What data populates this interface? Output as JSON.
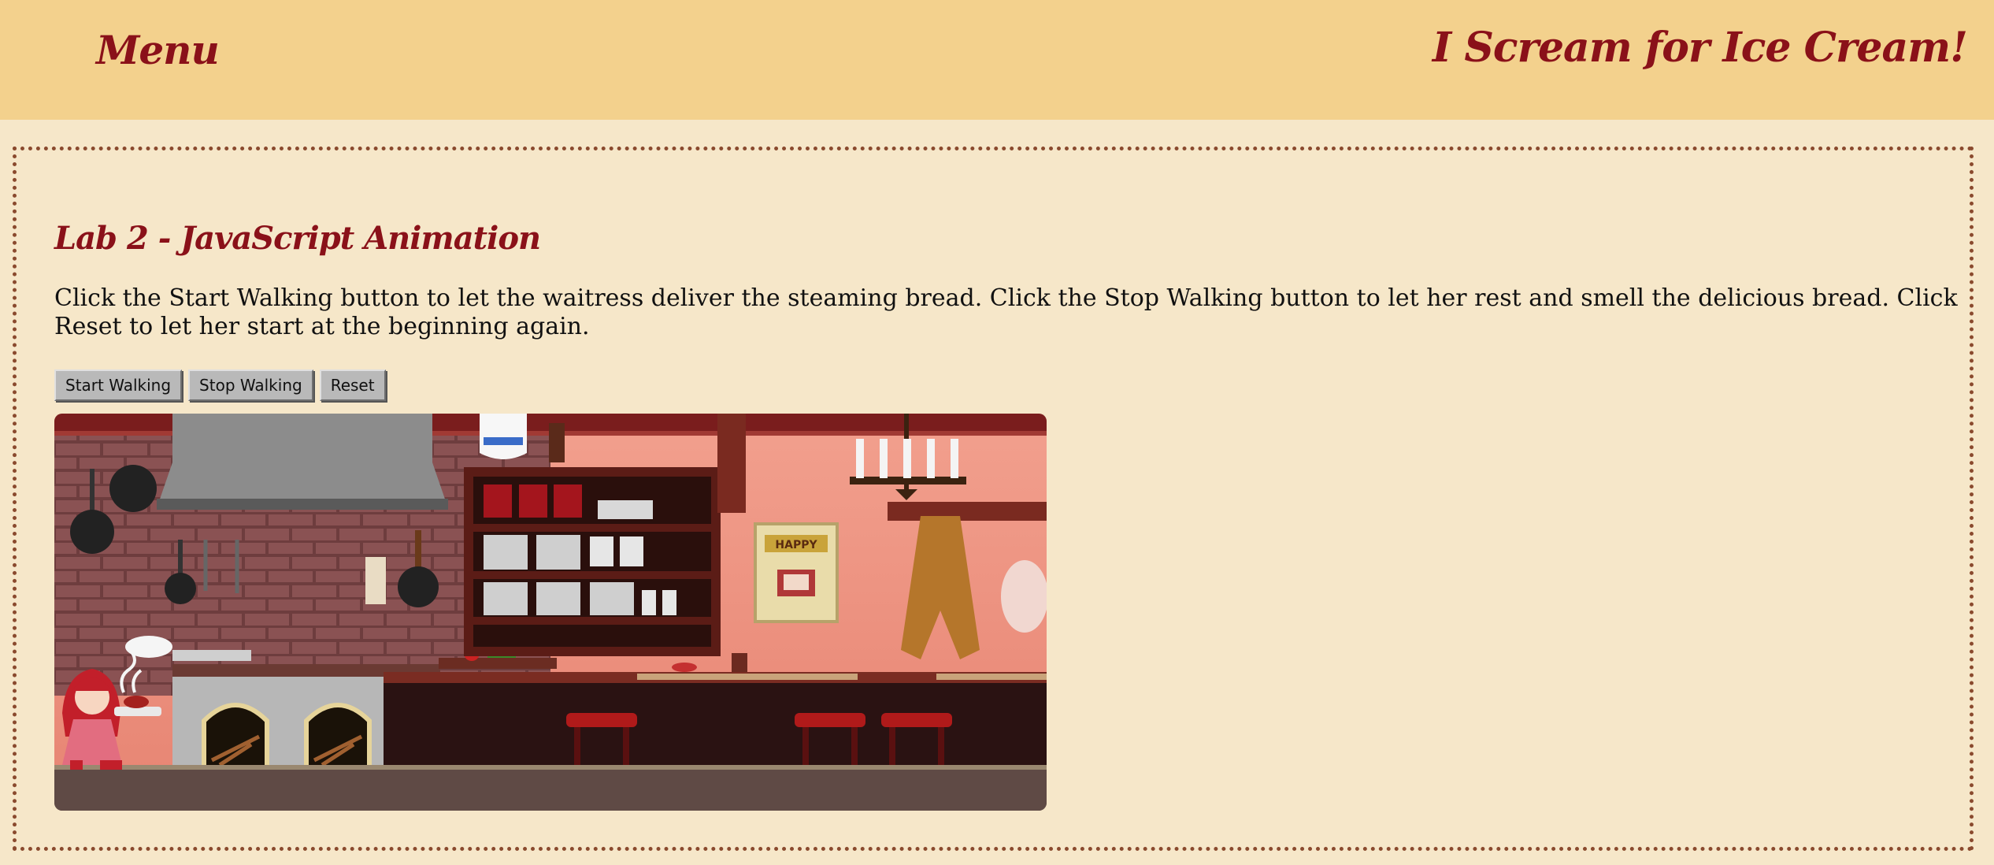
{
  "header": {
    "menu_label": "Menu",
    "site_title": "I Scream for Ice Cream!"
  },
  "main": {
    "heading": "Lab 2 - JavaScript Animation",
    "instructions": "Click the Start Walking button to let the waitress deliver the steaming bread. Click the Stop Walking button to let her rest and smell the delicious bread. Click Reset to let her start at the beginning again.",
    "buttons": {
      "start_label": "Start Walking",
      "stop_label": "Stop Walking",
      "reset_label": "Reset"
    },
    "sign_text": "HAPPY"
  },
  "colors": {
    "header_bg": "#f3d18d",
    "page_bg": "#f6e7c9",
    "title_red": "#8a1119",
    "border_brown": "#8a4a2e"
  }
}
